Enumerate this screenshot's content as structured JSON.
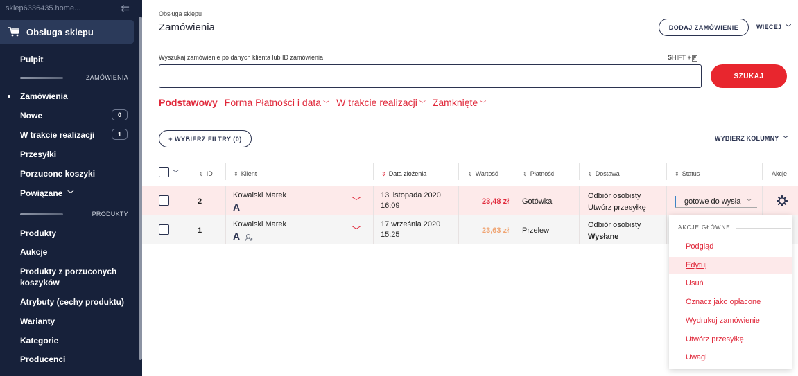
{
  "sidebar": {
    "store_name": "sklep6336435.home...",
    "section_title": "Obsługa sklepu",
    "items": [
      {
        "label": "Pulpit"
      },
      {
        "label": "Zamówienia"
      },
      {
        "label": "Nowe",
        "badge": "0"
      },
      {
        "label": "W trakcie realizacji",
        "badge": "1"
      },
      {
        "label": "Przesyłki"
      },
      {
        "label": "Porzucone koszyki"
      },
      {
        "label": "Powiązane"
      },
      {
        "label": "Produkty"
      },
      {
        "label": "Aukcje"
      },
      {
        "label": "Produkty z porzuconych"
      },
      {
        "label": "koszyków"
      },
      {
        "label": "Atrybuty (cechy produktu)"
      },
      {
        "label": "Warianty"
      },
      {
        "label": "Kategorie"
      },
      {
        "label": "Producenci"
      }
    ],
    "groups": {
      "orders": "ZAMÓWIENIA",
      "products": "PRODUKTY"
    }
  },
  "header": {
    "breadcrumb": "Obsługa sklepu",
    "title": "Zamówienia",
    "add_button": "DODAJ ZAMÓWIENIE",
    "more": "WIĘCEJ"
  },
  "search": {
    "label": "Wyszukaj zamówienie po danych klienta lub ID zamówienia",
    "shortcut": "SHIFT +",
    "shortcut_key": "F",
    "button": "SZUKAJ",
    "value": ""
  },
  "tabs": [
    {
      "label": "Podstawowy"
    },
    {
      "label": "Forma Płatności i data"
    },
    {
      "label": "W trakcie realizacji"
    },
    {
      "label": "Zamknięte"
    }
  ],
  "toolbar": {
    "filters": "+ WYBIERZ FILTRY (0)",
    "columns": "WYBIERZ KOLUMNY"
  },
  "table": {
    "columns": {
      "id": "ID",
      "client": "Klient",
      "date": "Data złożenia",
      "value": "Wartość",
      "payment": "Płatność",
      "delivery": "Dostawa",
      "status": "Status",
      "actions": "Akcje"
    },
    "rows": [
      {
        "id": "2",
        "client": "Kowalski Marek",
        "client_initial": "A",
        "date_line1": "13 listopada 2020",
        "date_line2": "16:09",
        "value": "23,48 zł",
        "payment": "Gotówka",
        "delivery": "Odbiór osobisty",
        "delivery_note": "Utwórz przesyłkę",
        "status": "gotowe do wysła"
      },
      {
        "id": "1",
        "client": "Kowalski Marek",
        "client_initial": "A",
        "date_line1": "17 września 2020",
        "date_line2": "15:25",
        "value": "23,63 zł",
        "payment": "Przelew",
        "delivery": "Odbiór osobisty",
        "delivery_note": "Wysłane"
      }
    ]
  },
  "actions_menu": {
    "header": "AKCJE GŁÓWNE",
    "items": [
      {
        "label": "Podgląd"
      },
      {
        "label": "Edytuj"
      },
      {
        "label": "Usuń"
      },
      {
        "label": "Oznacz jako opłacone"
      },
      {
        "label": "Wydrukuj zamówienie"
      },
      {
        "label": "Utwórz przesyłkę"
      },
      {
        "label": "Uwagi"
      }
    ]
  },
  "colors": {
    "sidebar_bg": "#17213a",
    "accent_red": "#e8262e",
    "row_highlight": "#fdeaea",
    "row_alt": "#f5f5f5"
  }
}
